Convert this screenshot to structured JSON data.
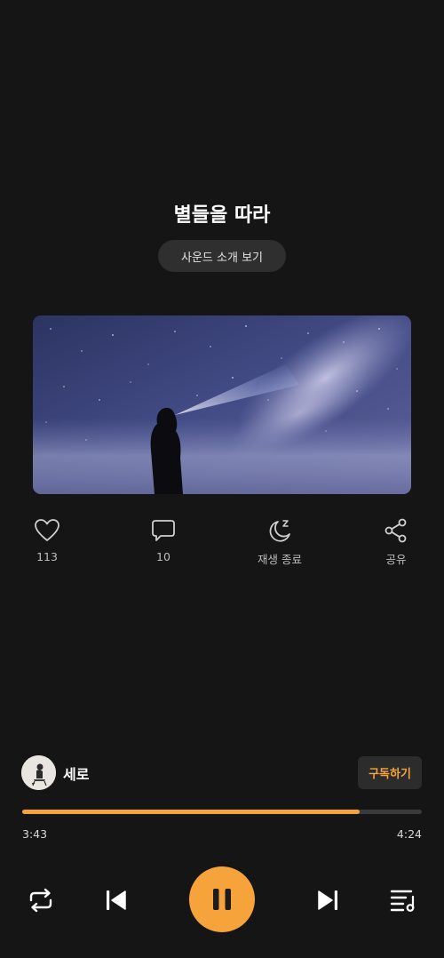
{
  "track": {
    "title": "별들을 따라"
  },
  "sound_button": {
    "label": "사운드 소개 보기"
  },
  "actions": {
    "like": {
      "icon": "heart-icon",
      "count": "113"
    },
    "comment": {
      "icon": "comment-icon",
      "count": "10"
    },
    "sleep": {
      "icon": "moon-zz-icon",
      "label": "재생 종료"
    },
    "share": {
      "icon": "share-icon",
      "label": "공유"
    }
  },
  "artist": {
    "name": "세로",
    "subscribe_label": "구독하기"
  },
  "player": {
    "current_time": "3:43",
    "total_time": "4:24",
    "progress": 0.845,
    "accent": "#f5a33a"
  },
  "controls": [
    "repeat-icon",
    "previous-icon",
    "pause-icon",
    "next-icon",
    "playlist-icon"
  ]
}
